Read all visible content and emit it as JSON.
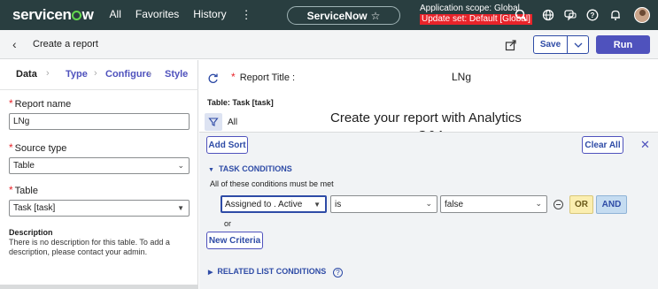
{
  "nav": {
    "logo": "servicenow",
    "links": [
      "All",
      "Favorites",
      "History"
    ],
    "more": "⋮",
    "instance_pill": "ServiceNow",
    "scope_line1": "Application scope: Global",
    "scope_line2": "Update set: Default [Global]"
  },
  "header": {
    "title": "Create a report",
    "save_label": "Save",
    "run_label": "Run"
  },
  "steps": [
    "Data",
    "Type",
    "Configure",
    "Style"
  ],
  "left": {
    "report_name_label": "Report name",
    "report_name_value": "LNg",
    "source_type_label": "Source type",
    "source_type_value": "Table",
    "table_label": "Table",
    "table_value": "Task [task]",
    "description_heading": "Description",
    "description_text": "There is no description for this table. To add a description, please contact your admin."
  },
  "right": {
    "report_title_label": "Report Title :",
    "report_title_value": "LNg",
    "table_label": "Table: Task [task]",
    "filter_all": "All",
    "create_msg": "Create your report with Analytics",
    "create_msg2": "Q&A"
  },
  "conditions": {
    "add_sort": "Add Sort",
    "clear_all": "Clear All",
    "task_conditions": "TASK CONDITIONS",
    "all_met": "All of these conditions must be met",
    "field": "Assigned to . Active",
    "operator": "is",
    "value": "false",
    "or_button": "OR",
    "and_button": "AND",
    "or_label": "or",
    "new_criteria": "New Criteria",
    "related_list": "RELATED LIST CONDITIONS"
  }
}
